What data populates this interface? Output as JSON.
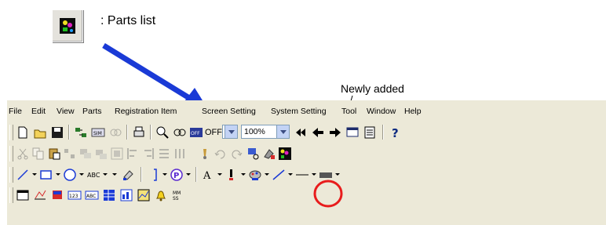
{
  "annotation": {
    "legend_label": ": Parts list",
    "newly_added_label": "Newly added"
  },
  "menu": {
    "items": [
      "File",
      "Edit",
      "View",
      "Parts",
      "Registration Item",
      "Screen Setting",
      "System Setting",
      "Tool",
      "Window",
      "Help"
    ]
  },
  "toolbar1": {
    "switch_label": "OFF",
    "zoom_value": "100%"
  },
  "toolbar3": {
    "text_tool_label": "ABC",
    "font_tool_label": "A"
  },
  "colors": {
    "arrow": "#1a3ad6",
    "highlight_circle": "#e81c1c",
    "toolbar_bg": "#ece9d8"
  }
}
